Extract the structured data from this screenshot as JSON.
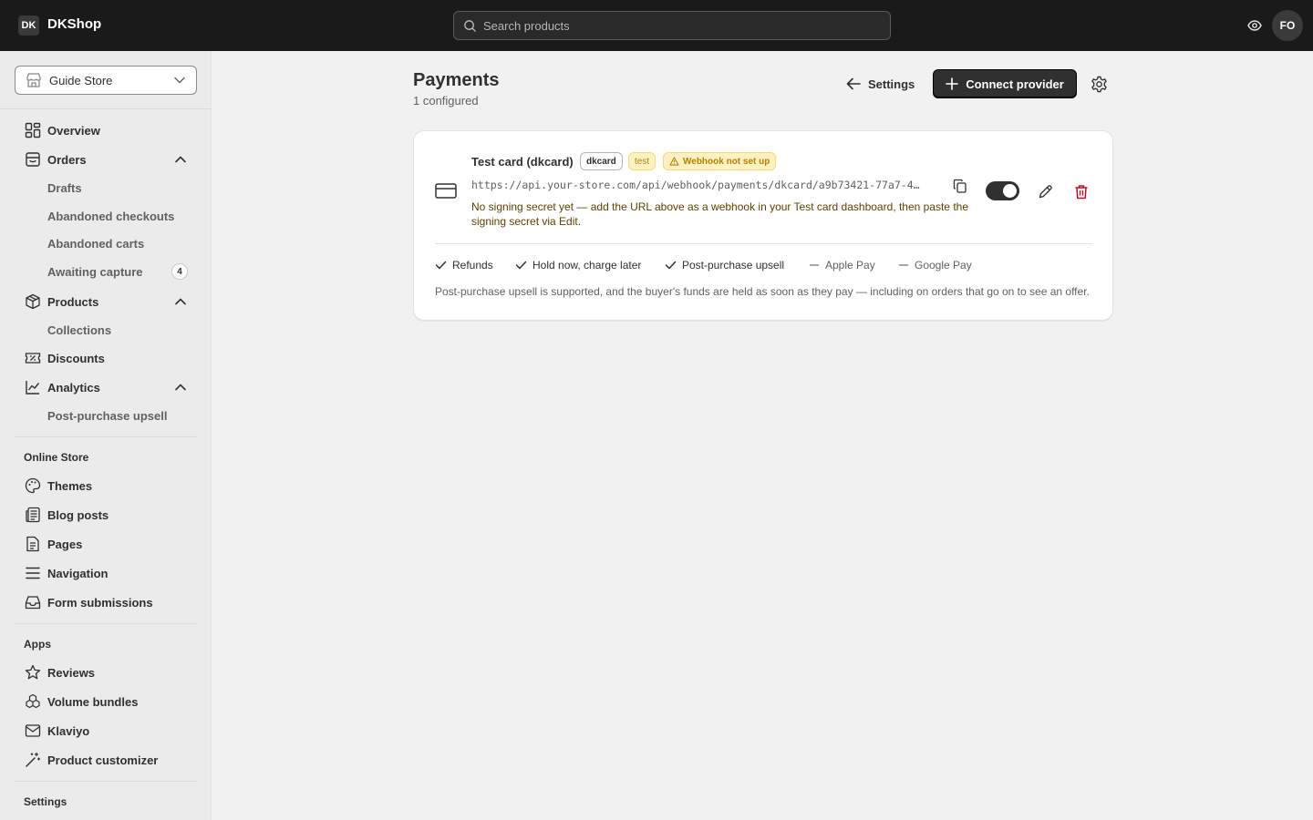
{
  "topbar": {
    "logo_initials": "DK",
    "brand": "DKShop",
    "search_placeholder": "Search products",
    "avatar_initials": "FO"
  },
  "sidebar": {
    "store_name": "Guide Store",
    "main_items": [
      {
        "label": "Overview",
        "icon": "grid-icon"
      },
      {
        "label": "Orders",
        "icon": "inbox-icon",
        "expanded": true
      },
      {
        "label": "Products",
        "icon": "tag-icon",
        "expanded": true
      },
      {
        "label": "Discounts",
        "icon": "discount-icon"
      },
      {
        "label": "Analytics",
        "icon": "chart-icon",
        "expanded": true
      }
    ],
    "orders_sub": [
      "Drafts",
      "Abandoned checkouts",
      "Abandoned carts",
      "Awaiting capture"
    ],
    "awaiting_capture_count": "4",
    "products_sub": [
      "Collections"
    ],
    "analytics_sub": [
      "Post-purchase upsell"
    ],
    "online_store_title": "Online Store",
    "online_store_items": [
      {
        "label": "Themes",
        "icon": "palette-icon"
      },
      {
        "label": "Blog posts",
        "icon": "blog-icon"
      },
      {
        "label": "Pages",
        "icon": "page-icon"
      },
      {
        "label": "Navigation",
        "icon": "menu-icon"
      },
      {
        "label": "Form submissions",
        "icon": "inbox-tray-icon"
      }
    ],
    "apps_title": "Apps",
    "apps_items": [
      {
        "label": "Reviews",
        "icon": "star-icon"
      },
      {
        "label": "Volume bundles",
        "icon": "bundle-icon"
      },
      {
        "label": "Klaviyo",
        "icon": "mail-icon"
      },
      {
        "label": "Product customizer",
        "icon": "wand-icon"
      }
    ],
    "settings_title": "Settings"
  },
  "header": {
    "title": "Payments",
    "subtitle": "1 configured",
    "back_label": "Settings",
    "connect_label": "Connect provider"
  },
  "provider": {
    "name": "Test card (dkcard)",
    "code": "dkcard",
    "mode": "test",
    "warning_badge": "Webhook not set up",
    "webhook_url": "https://api.your-store.com/api/webhook/payments/dkcard/a9b73421-77a7-4…",
    "warning_text": "No signing secret yet — add the URL above as a webhook in your Test card dashboard, then paste the signing secret via Edit.",
    "enabled": true,
    "capabilities": [
      {
        "label": "Refunds",
        "supported": true
      },
      {
        "label": "Hold now, charge later",
        "supported": true
      },
      {
        "label": "Post-purchase upsell",
        "supported": true
      },
      {
        "label": "Apple Pay",
        "supported": false
      },
      {
        "label": "Google Pay",
        "supported": false
      }
    ],
    "note": "Post-purchase upsell is supported, and the buyer's funds are held as soon as they pay — including on orders that go on to see an offer."
  },
  "colors": {
    "topbar": "#1a1a1a",
    "primary_button": "#303030",
    "warning_bg": "#fff1c2",
    "warning_text": "#b28400",
    "delete": "#c70a24"
  }
}
